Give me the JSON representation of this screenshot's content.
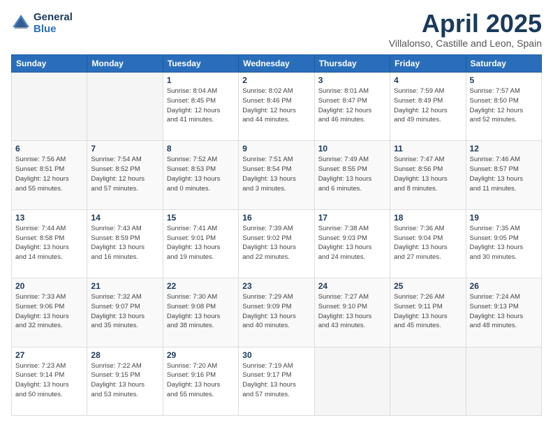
{
  "header": {
    "logo_line1": "General",
    "logo_line2": "Blue",
    "month": "April 2025",
    "location": "Villalonso, Castille and Leon, Spain"
  },
  "weekdays": [
    "Sunday",
    "Monday",
    "Tuesday",
    "Wednesday",
    "Thursday",
    "Friday",
    "Saturday"
  ],
  "weeks": [
    [
      {
        "day": "",
        "info": ""
      },
      {
        "day": "",
        "info": ""
      },
      {
        "day": "1",
        "info": "Sunrise: 8:04 AM\nSunset: 8:45 PM\nDaylight: 12 hours\nand 41 minutes."
      },
      {
        "day": "2",
        "info": "Sunrise: 8:02 AM\nSunset: 8:46 PM\nDaylight: 12 hours\nand 44 minutes."
      },
      {
        "day": "3",
        "info": "Sunrise: 8:01 AM\nSunset: 8:47 PM\nDaylight: 12 hours\nand 46 minutes."
      },
      {
        "day": "4",
        "info": "Sunrise: 7:59 AM\nSunset: 8:49 PM\nDaylight: 12 hours\nand 49 minutes."
      },
      {
        "day": "5",
        "info": "Sunrise: 7:57 AM\nSunset: 8:50 PM\nDaylight: 12 hours\nand 52 minutes."
      }
    ],
    [
      {
        "day": "6",
        "info": "Sunrise: 7:56 AM\nSunset: 8:51 PM\nDaylight: 12 hours\nand 55 minutes."
      },
      {
        "day": "7",
        "info": "Sunrise: 7:54 AM\nSunset: 8:52 PM\nDaylight: 12 hours\nand 57 minutes."
      },
      {
        "day": "8",
        "info": "Sunrise: 7:52 AM\nSunset: 8:53 PM\nDaylight: 13 hours\nand 0 minutes."
      },
      {
        "day": "9",
        "info": "Sunrise: 7:51 AM\nSunset: 8:54 PM\nDaylight: 13 hours\nand 3 minutes."
      },
      {
        "day": "10",
        "info": "Sunrise: 7:49 AM\nSunset: 8:55 PM\nDaylight: 13 hours\nand 6 minutes."
      },
      {
        "day": "11",
        "info": "Sunrise: 7:47 AM\nSunset: 8:56 PM\nDaylight: 13 hours\nand 8 minutes."
      },
      {
        "day": "12",
        "info": "Sunrise: 7:46 AM\nSunset: 8:57 PM\nDaylight: 13 hours\nand 11 minutes."
      }
    ],
    [
      {
        "day": "13",
        "info": "Sunrise: 7:44 AM\nSunset: 8:58 PM\nDaylight: 13 hours\nand 14 minutes."
      },
      {
        "day": "14",
        "info": "Sunrise: 7:43 AM\nSunset: 8:59 PM\nDaylight: 13 hours\nand 16 minutes."
      },
      {
        "day": "15",
        "info": "Sunrise: 7:41 AM\nSunset: 9:01 PM\nDaylight: 13 hours\nand 19 minutes."
      },
      {
        "day": "16",
        "info": "Sunrise: 7:39 AM\nSunset: 9:02 PM\nDaylight: 13 hours\nand 22 minutes."
      },
      {
        "day": "17",
        "info": "Sunrise: 7:38 AM\nSunset: 9:03 PM\nDaylight: 13 hours\nand 24 minutes."
      },
      {
        "day": "18",
        "info": "Sunrise: 7:36 AM\nSunset: 9:04 PM\nDaylight: 13 hours\nand 27 minutes."
      },
      {
        "day": "19",
        "info": "Sunrise: 7:35 AM\nSunset: 9:05 PM\nDaylight: 13 hours\nand 30 minutes."
      }
    ],
    [
      {
        "day": "20",
        "info": "Sunrise: 7:33 AM\nSunset: 9:06 PM\nDaylight: 13 hours\nand 32 minutes."
      },
      {
        "day": "21",
        "info": "Sunrise: 7:32 AM\nSunset: 9:07 PM\nDaylight: 13 hours\nand 35 minutes."
      },
      {
        "day": "22",
        "info": "Sunrise: 7:30 AM\nSunset: 9:08 PM\nDaylight: 13 hours\nand 38 minutes."
      },
      {
        "day": "23",
        "info": "Sunrise: 7:29 AM\nSunset: 9:09 PM\nDaylight: 13 hours\nand 40 minutes."
      },
      {
        "day": "24",
        "info": "Sunrise: 7:27 AM\nSunset: 9:10 PM\nDaylight: 13 hours\nand 43 minutes."
      },
      {
        "day": "25",
        "info": "Sunrise: 7:26 AM\nSunset: 9:11 PM\nDaylight: 13 hours\nand 45 minutes."
      },
      {
        "day": "26",
        "info": "Sunrise: 7:24 AM\nSunset: 9:13 PM\nDaylight: 13 hours\nand 48 minutes."
      }
    ],
    [
      {
        "day": "27",
        "info": "Sunrise: 7:23 AM\nSunset: 9:14 PM\nDaylight: 13 hours\nand 50 minutes."
      },
      {
        "day": "28",
        "info": "Sunrise: 7:22 AM\nSunset: 9:15 PM\nDaylight: 13 hours\nand 53 minutes."
      },
      {
        "day": "29",
        "info": "Sunrise: 7:20 AM\nSunset: 9:16 PM\nDaylight: 13 hours\nand 55 minutes."
      },
      {
        "day": "30",
        "info": "Sunrise: 7:19 AM\nSunset: 9:17 PM\nDaylight: 13 hours\nand 57 minutes."
      },
      {
        "day": "",
        "info": ""
      },
      {
        "day": "",
        "info": ""
      },
      {
        "day": "",
        "info": ""
      }
    ]
  ]
}
